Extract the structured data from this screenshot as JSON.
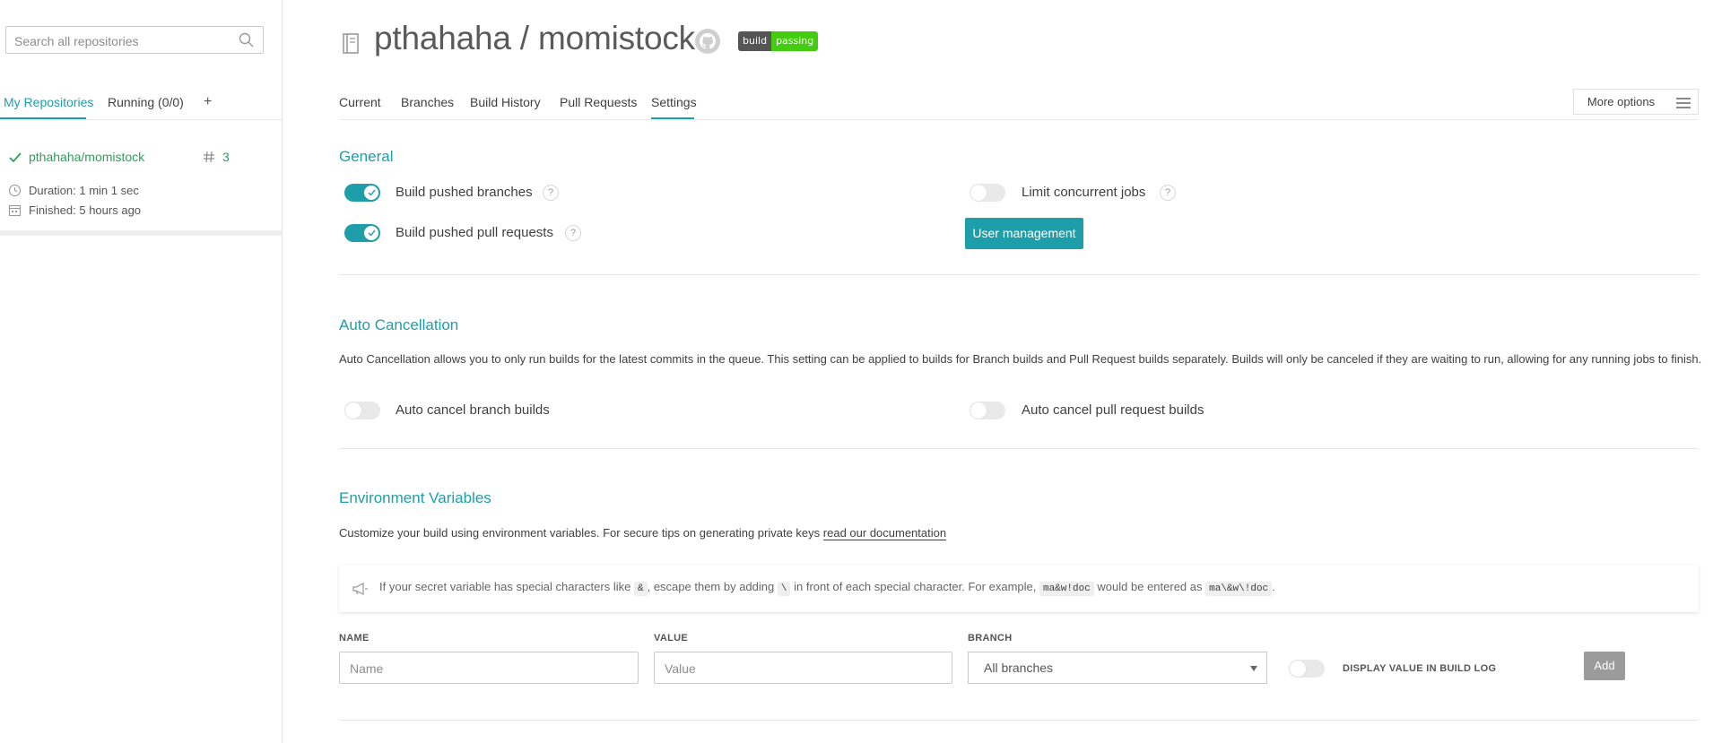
{
  "sidebar": {
    "search_placeholder": "Search all repositories",
    "tabs": {
      "my_repositories": "My Repositories",
      "running": "Running (0/0)",
      "add": "+"
    },
    "repo": {
      "name": "pthahaha/momistock",
      "build_number": "3",
      "duration": "Duration: 1 min 1 sec",
      "finished": "Finished: 5 hours ago"
    }
  },
  "header": {
    "repo_title": "pthahaha / momistock",
    "badge": {
      "left": "build",
      "right": "passing"
    },
    "icons": [
      "repo-book-icon",
      "github-icon"
    ]
  },
  "tabs": {
    "current": "Current",
    "branches": "Branches",
    "build_history": "Build History",
    "pull_requests": "Pull Requests",
    "settings": "Settings",
    "active": "settings"
  },
  "more_options": "More options",
  "general": {
    "title": "General",
    "build_pushed_branches": "Build pushed branches",
    "build_pushed_pull_requests": "Build pushed pull requests",
    "limit_concurrent_jobs": "Limit concurrent jobs",
    "user_management": "User management",
    "help": "?",
    "toggles": {
      "build_pushed_branches": true,
      "build_pushed_pull_requests": true,
      "limit_concurrent_jobs": false
    }
  },
  "auto_cancellation": {
    "title": "Auto Cancellation",
    "description": "Auto Cancellation allows you to only run builds for the latest commits in the queue. This setting can be applied to builds for Branch builds and Pull Request builds separately. Builds will only be canceled if they are waiting to run, allowing for any running jobs to finish.",
    "branch_builds": "Auto cancel branch builds",
    "pull_request_builds": "Auto cancel pull request builds",
    "toggles": {
      "branch_builds": false,
      "pull_request_builds": false
    }
  },
  "env_vars": {
    "title": "Environment Variables",
    "description": "Customize your build using environment variables. For secure tips on generating private keys",
    "doc_link": "read our documentation",
    "tip": {
      "part1": "If your secret variable has special characters like",
      "code1": "&",
      "part2": ", escape them by adding",
      "code2": "\\",
      "part3": "in front of each special character. For example,",
      "code3": "ma&w!doc",
      "part4": "would be entered as",
      "code4": "ma\\&w\\!doc",
      "part5": "."
    },
    "name_label": "NAME",
    "name_placeholder": "Name",
    "value_label": "VALUE",
    "value_placeholder": "Value",
    "branch_label": "BRANCH",
    "branch_value": "All branches",
    "display_value_label": "DISPLAY VALUE IN BUILD LOG",
    "display_value_toggle": false,
    "add_button": "Add"
  },
  "colors": {
    "accent": "#1e9ea8",
    "success": "#2aa15a",
    "badge_pass": "#44cc11"
  }
}
